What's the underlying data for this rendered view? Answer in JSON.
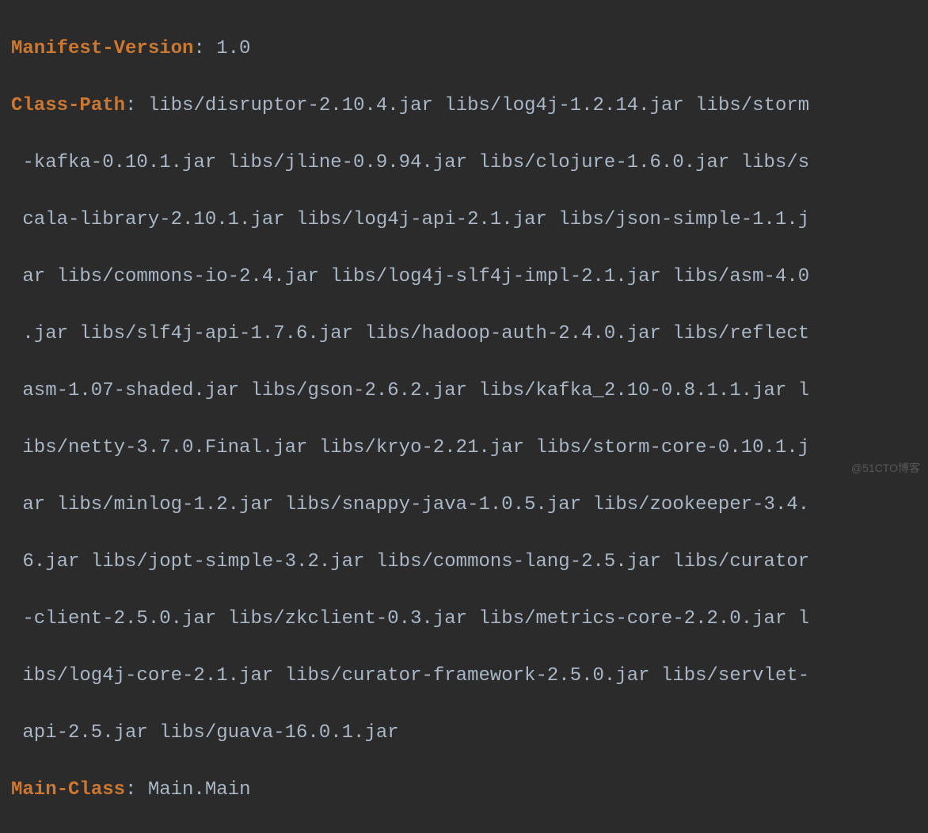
{
  "manifest": {
    "version_key": "Manifest-Version",
    "version_value": "1.0",
    "classpath_key": "Class-Path",
    "classpath_lines": [
      "libs/disruptor-2.10.4.jar libs/log4j-1.2.14.jar libs/storm",
      "-kafka-0.10.1.jar libs/jline-0.9.94.jar libs/clojure-1.6.0.jar libs/s",
      "cala-library-2.10.1.jar libs/log4j-api-2.1.jar libs/json-simple-1.1.j",
      "ar libs/commons-io-2.4.jar libs/log4j-slf4j-impl-2.1.jar libs/asm-4.0",
      ".jar libs/slf4j-api-1.7.6.jar libs/hadoop-auth-2.4.0.jar libs/reflect",
      "asm-1.07-shaded.jar libs/gson-2.6.2.jar libs/kafka_2.10-0.8.1.1.jar l",
      "ibs/netty-3.7.0.Final.jar libs/kryo-2.21.jar libs/storm-core-0.10.1.j",
      "ar libs/minlog-1.2.jar libs/snappy-java-1.0.5.jar libs/zookeeper-3.4.",
      "6.jar libs/jopt-simple-3.2.jar libs/commons-lang-2.5.jar libs/curator",
      "-client-2.5.0.jar libs/zkclient-0.3.jar libs/metrics-core-2.2.0.jar l",
      "ibs/log4j-core-2.1.jar libs/curator-framework-2.5.0.jar libs/servlet-",
      "api-2.5.jar libs/guava-16.0.1.jar"
    ],
    "mainclass_key": "Main-Class",
    "mainclass_value": "Main.Main"
  },
  "watermark": "@51CTO博客"
}
